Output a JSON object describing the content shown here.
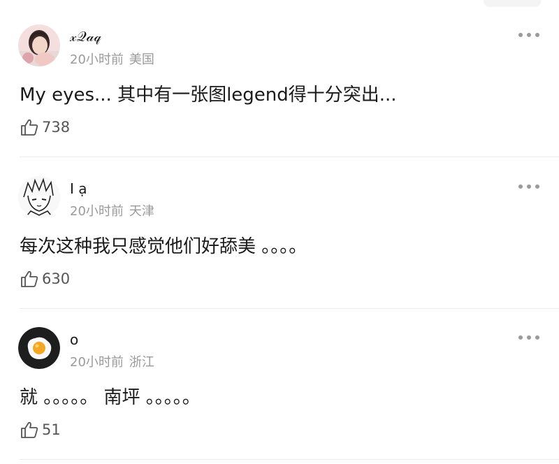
{
  "comments": [
    {
      "username": "𝓍𝒬𝒶𝓆",
      "time": "20小时前",
      "location": "美国",
      "text": "My eyes... 其中有一张图legend得十分突出...",
      "likes": "738",
      "avatar_icon": "girl-portrait"
    },
    {
      "username": "I ạ",
      "time": "20小时前",
      "location": "天津",
      "text": "每次这种我只感觉他们好舔美 。。。。",
      "likes": "630",
      "avatar_icon": "anime-character-sketch"
    },
    {
      "username": "o",
      "time": "20小时前",
      "location": "浙江",
      "text": "就 。。。。。 南坪 。。。。。",
      "likes": "51",
      "avatar_icon": "fried-egg"
    }
  ],
  "colors": {
    "text": "#1a1a1a",
    "meta": "#9a9a9a",
    "divider": "#ececec"
  }
}
